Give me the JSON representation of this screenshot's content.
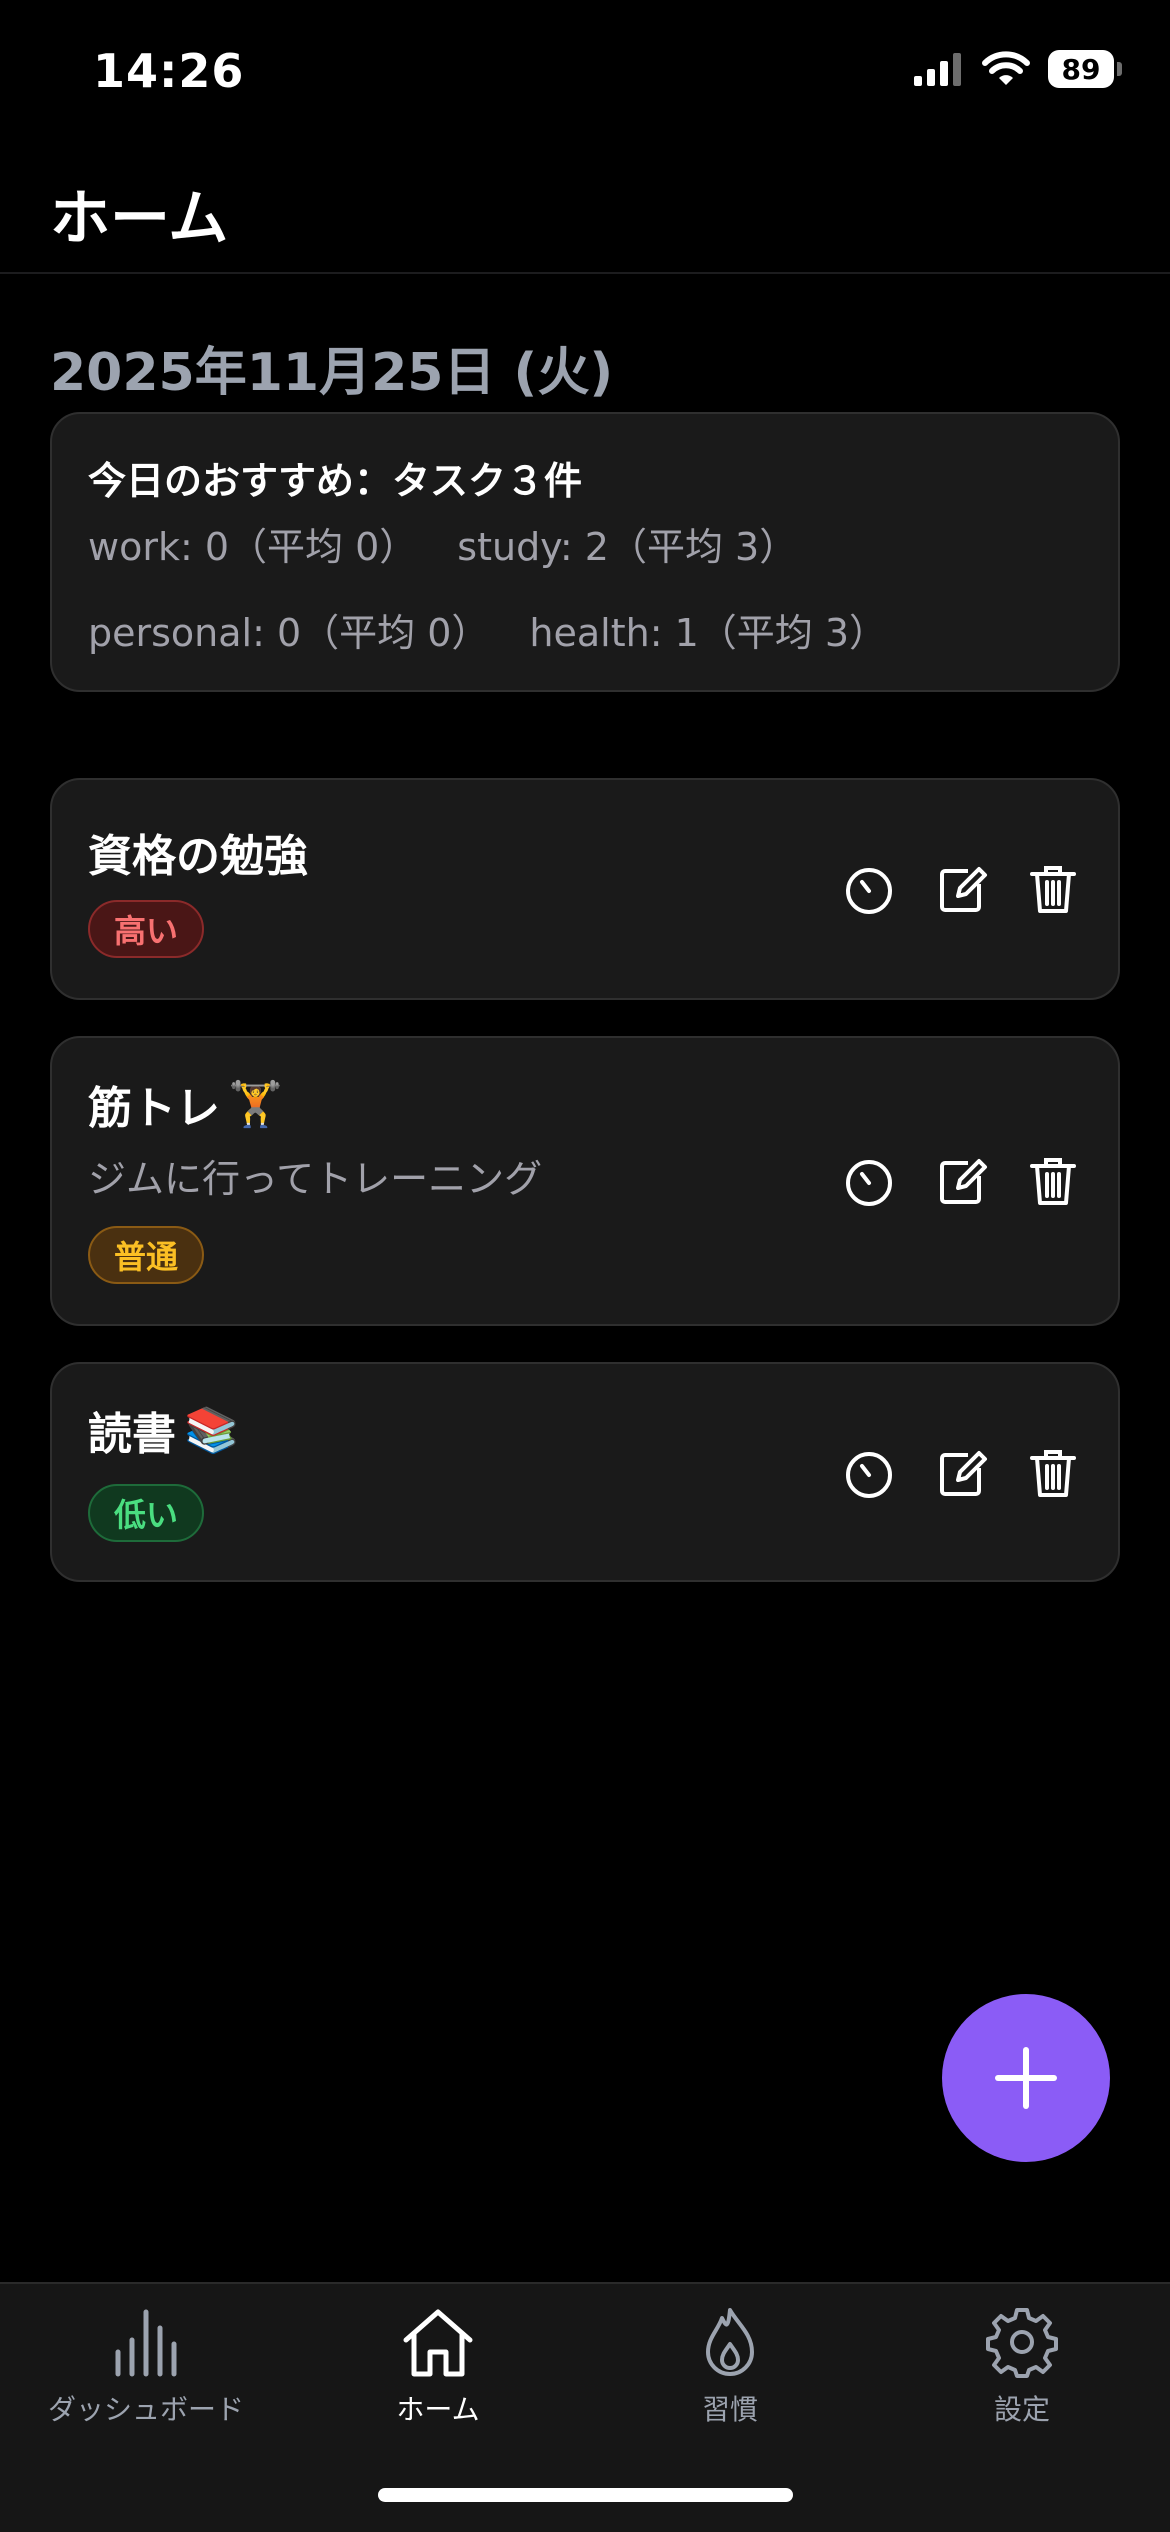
{
  "status_bar": {
    "time": "14:26",
    "battery": "89"
  },
  "header": {
    "title": "ホーム"
  },
  "date": "2025年11月25日 (火)",
  "recommendation": {
    "title": "今日のおすすめ：タスク３件",
    "stats": [
      "work: 0（平均 0）",
      "study: 2（平均 3）",
      "personal: 0（平均 0）",
      "health: 1（平均 3）"
    ]
  },
  "tasks": [
    {
      "title": "資格の勉強",
      "emoji": "",
      "description": "",
      "priority": "高い"
    },
    {
      "title": "筋トレ",
      "emoji": "🏋️",
      "description": "ジムに行ってトレーニング",
      "priority": "普通"
    },
    {
      "title": "読書",
      "emoji": "📚",
      "description": "",
      "priority": "低い"
    }
  ],
  "nav": [
    {
      "label": "ダッシュボード",
      "icon": "chart-bars-icon"
    },
    {
      "label": "ホーム",
      "icon": "home-icon",
      "active": true
    },
    {
      "label": "習慣",
      "icon": "flame-icon"
    },
    {
      "label": "設定",
      "icon": "gear-icon"
    }
  ],
  "colors": {
    "accent": "#8b5cf6",
    "high": "#f87171",
    "medium": "#fbbf24",
    "low": "#4ade80"
  }
}
